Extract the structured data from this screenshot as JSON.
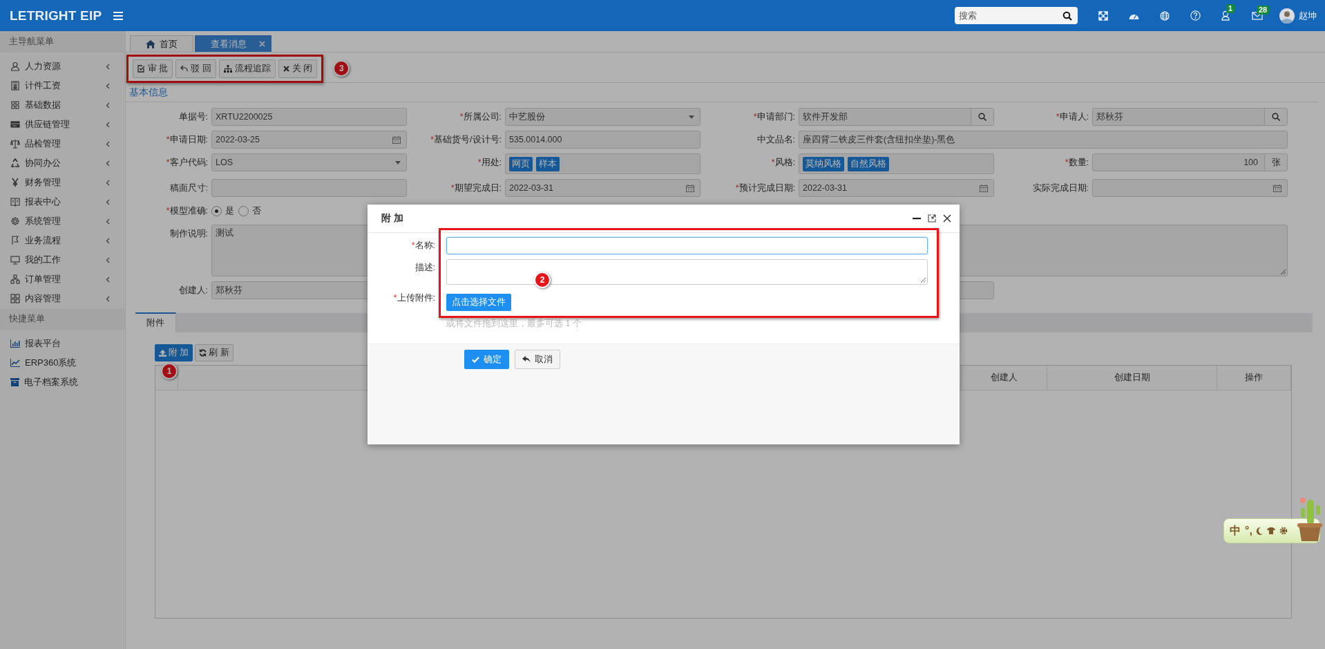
{
  "topbar": {
    "logo": "LETRIGHT EIP",
    "search": {
      "placeholder": "搜索"
    },
    "counters": [
      {
        "kind": "user",
        "count": "1"
      },
      {
        "kind": "mail",
        "count": "28"
      }
    ],
    "user": "赵坤"
  },
  "sidebar": {
    "main_header": "主导航菜单",
    "items": [
      "人力资源",
      "计件工资",
      "基础数据",
      "供应链管理",
      "品检管理",
      "协同办公",
      "财务管理",
      "报表中心",
      "系统管理",
      "业务流程",
      "我的工作",
      "订单管理",
      "内容管理"
    ],
    "quick_header": "快捷菜单",
    "quick_items": [
      "报表平台",
      "ERP360系统",
      "电子档案系统"
    ]
  },
  "tabs": [
    {
      "label": "首页",
      "selected": false,
      "closable": false
    },
    {
      "label": "查看消息",
      "selected": true,
      "closable": true
    }
  ],
  "toolbar": [
    "审 批",
    "驳 回",
    "流程追踪",
    "关 闭"
  ],
  "section_title": "基本信息",
  "form_rows": [
    [
      {
        "kind": "text",
        "label": "单据号:",
        "value": "XRTU2200025"
      },
      {
        "kind": "select",
        "mark": "*",
        "label": "所属公司:",
        "value": "中艺股份"
      },
      {
        "kind": "lookup",
        "mark": "*",
        "label": "申请部门:",
        "value": "软件开发部"
      },
      {
        "kind": "lookup",
        "mark": "*",
        "label": "申请人:",
        "value": "郑秋芬"
      }
    ],
    [
      {
        "kind": "date",
        "mark": "*",
        "label": "申请日期:",
        "value": "2022-03-25"
      },
      {
        "kind": "text",
        "mark": "*",
        "label": "基础货号/设计号:",
        "value": "535.0014.000"
      },
      {
        "kind": "long_text",
        "label": "中文品名:",
        "value": "座四背二铁皮三件套(含纽扣坐垫)-黑色"
      }
    ],
    [
      {
        "kind": "select",
        "mark": "*",
        "label": "客户代码:",
        "value": "LOS"
      },
      {
        "kind": "tags",
        "mark": "*",
        "label": "用处:",
        "tags": [
          "网页",
          "样本"
        ]
      },
      {
        "kind": "tags",
        "mark": "*",
        "label": "风格:",
        "tags": [
          "莫纳风格",
          "自然风格"
        ]
      },
      {
        "kind": "quantity",
        "mark": "*",
        "label": "数量:",
        "value": "100",
        "unit": "张"
      }
    ],
    [
      {
        "kind": "text",
        "label": "稿面尺寸:"
      },
      {
        "kind": "date",
        "mark": "*",
        "label": "期望完成日:",
        "value": "2022-03-31"
      },
      {
        "kind": "date",
        "mark": "*",
        "label": "预计完成日期:",
        "value": "2022-03-31"
      },
      {
        "kind": "date",
        "label": "实际完成日期:"
      }
    ],
    [
      {
        "kind": "radio",
        "mark": "*",
        "label": "模型准确:",
        "options": [
          {
            "label": "是",
            "selected": true
          },
          {
            "label": "否",
            "selected": false
          }
        ]
      }
    ],
    [
      {
        "kind": "textarea",
        "label": "制作说明:",
        "value": "测试"
      }
    ],
    [
      {
        "kind": "text",
        "label": "创建人:",
        "value": "郑秋芬"
      },
      {
        "kind": "gap"
      },
      {
        "kind": "text"
      }
    ]
  ],
  "attachments": {
    "tabs": [
      {
        "label": "附件",
        "selected": true
      }
    ],
    "buttons": [
      {
        "label": "附 加",
        "kind": "primary"
      },
      {
        "label": "刷 新",
        "kind": "default"
      }
    ],
    "columns": [
      {},
      {},
      {
        "label": "创建人"
      },
      {
        "label": "创建日期"
      },
      {
        "label": "操作"
      }
    ]
  },
  "dialog": {
    "title": "附 加",
    "fields": [
      {
        "kind": "input",
        "mark": "*",
        "label": "名称:",
        "focused": true
      },
      {
        "kind": "textarea",
        "label": "描述:"
      },
      {
        "kind": "upload",
        "mark": "*",
        "label": "上传附件:",
        "button": "点击选择文件",
        "hint": "或将文件拖到这里，最多可选 1 个"
      }
    ],
    "buttons": [
      {
        "label": "确定",
        "kind": "primary"
      },
      {
        "label": "取消",
        "kind": "default"
      }
    ]
  },
  "callouts": [
    "1",
    "2",
    "3"
  ],
  "ime": {
    "mode": "中",
    "punctuation": "°,"
  }
}
